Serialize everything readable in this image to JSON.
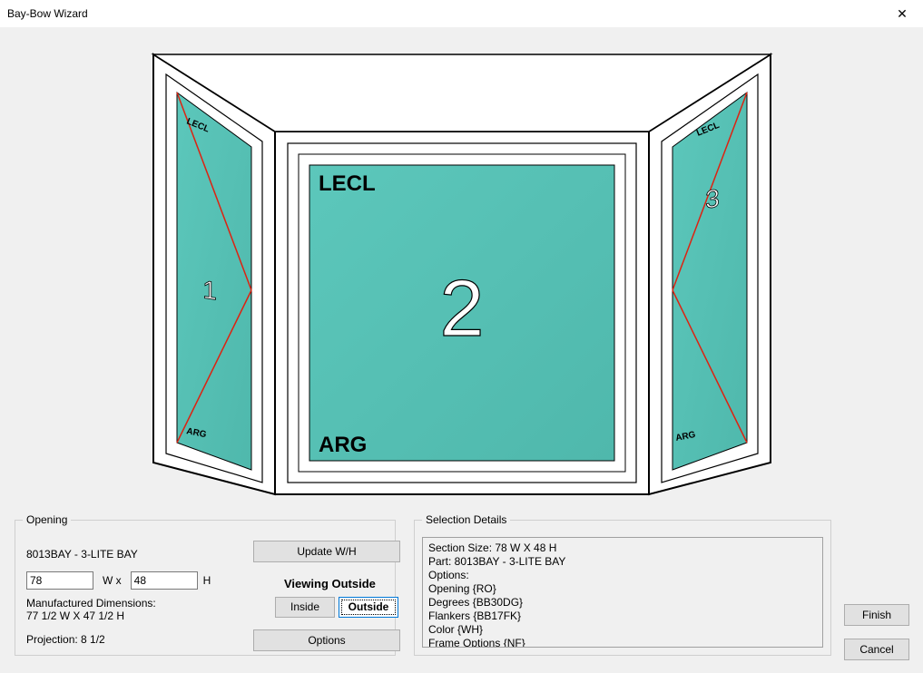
{
  "window": {
    "title": "Bay-Bow Wizard",
    "close_label": "✕"
  },
  "drawing": {
    "center_top_label": "LECL",
    "center_bottom_label": "ARG",
    "flanker_top_label": "LECL",
    "flanker_bottom_label": "ARG",
    "panel_numbers": [
      "1",
      "2",
      "3"
    ]
  },
  "opening": {
    "legend": "Opening",
    "part_label": "8013BAY - 3-LITE BAY",
    "update_btn": "Update W/H",
    "width_value": "78",
    "wx_label": "W x",
    "height_value": "48",
    "h_label": "H",
    "mfg_label": "Manufactured Dimensions:",
    "mfg_value": "77  1/2 W X 47  1/2 H",
    "projection_label": "Projection: 8  1/2",
    "viewing_label": "Viewing Outside",
    "inside_label": "Inside",
    "outside_label": "Outside",
    "options_btn": "Options"
  },
  "details": {
    "legend": "Selection Details",
    "lines": [
      "Section Size: 78 W X 48 H",
      "Part: 8013BAY - 3-LITE BAY",
      "Options:",
      "Opening {RO}",
      "Degrees {BB30DG}",
      "Flankers {BB17FK}",
      "Color {WH}",
      "Frame Options {NF}"
    ]
  },
  "actions": {
    "finish": "Finish",
    "cancel": "Cancel"
  }
}
